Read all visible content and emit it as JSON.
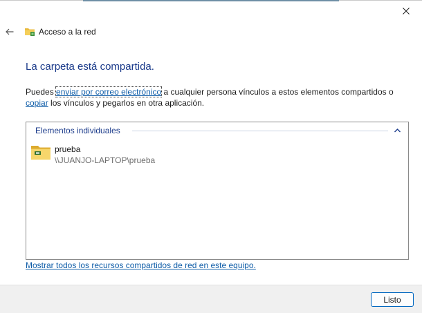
{
  "window": {
    "close_icon": "close-icon"
  },
  "header": {
    "back_icon": "back-arrow-icon",
    "app_icon": "network-folder-icon",
    "title": "Acceso a la red"
  },
  "main": {
    "heading": "La carpeta está compartida.",
    "desc_prefix": "Puedes ",
    "email_link": "enviar por correo electrónico",
    "desc_middle": " a cualquier persona vínculos a estos elementos compartidos o ",
    "copy_link": "copiar",
    "desc_suffix": " los vínculos y pegarlos en otra aplicación."
  },
  "list": {
    "group_label": "Elementos individuales",
    "collapse_icon": "chevron-up-icon",
    "items": [
      {
        "icon": "shared-folder-icon",
        "name": "prueba",
        "path": "\\\\JUANJO-LAPTOP\\prueba"
      }
    ]
  },
  "show_all_link": "Mostrar todos los recursos compartidos de red en este equipo.",
  "footer": {
    "ok_label": "Listo"
  }
}
